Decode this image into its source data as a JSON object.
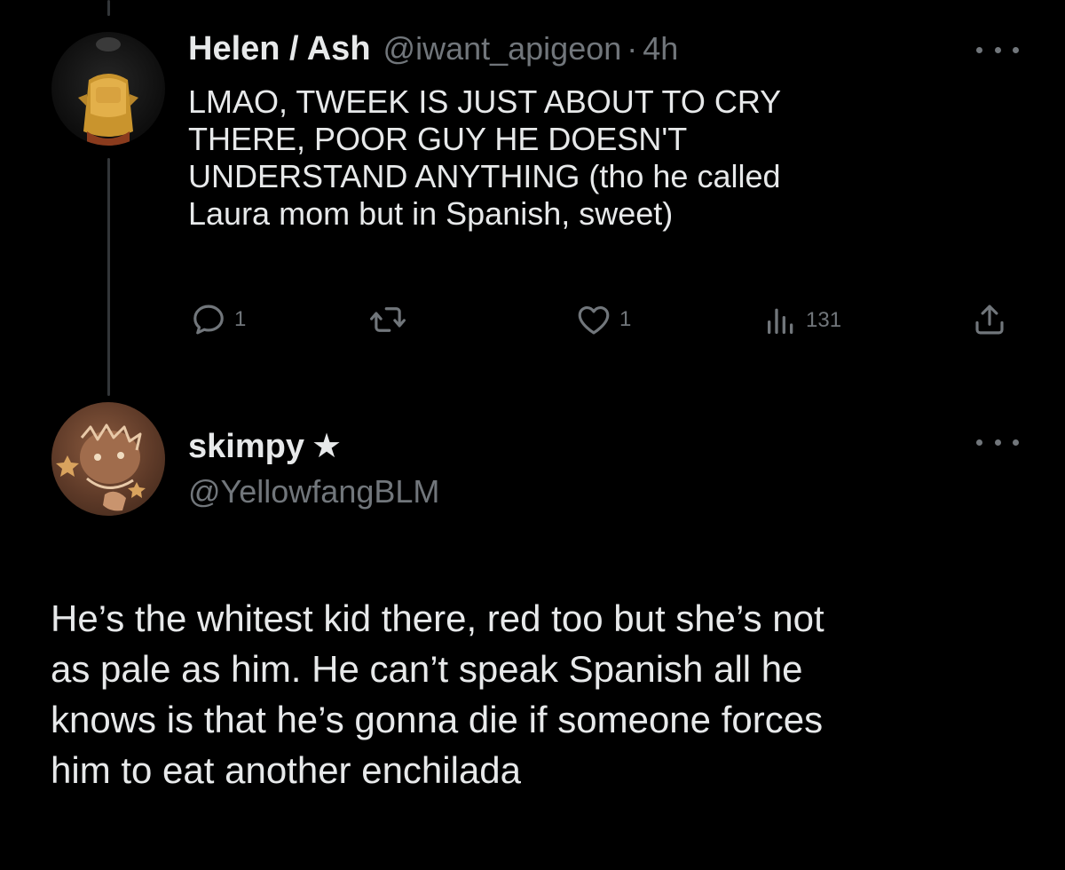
{
  "tweet": {
    "display_name": "Helen / Ash",
    "handle": "@iwant_apigeon",
    "separator": "·",
    "time": "4h",
    "text": "LMAO, TWEEK IS JUST ABOUT TO CRY\nTHERE, POOR GUY HE DOESN'T\nUNDERSTAND ANYTHING (tho he called\nLaura mom but in Spanish, sweet)",
    "replies": "1",
    "likes": "1",
    "views": "131",
    "icons": [
      "reply-icon",
      "retweet-icon",
      "like-icon",
      "views-icon",
      "share-icon",
      "more-icon"
    ]
  },
  "reply": {
    "display_name": "skimpy",
    "badge_glyph": "★",
    "handle": "@YellowfangBLM",
    "text": "He’s the whitest kid there, red too but she’s not\nas pale as him. He can’t speak Spanish all he\nknows is that he’s gonna die if someone forces\nhim to eat another enchilada"
  },
  "colors": {
    "background": "#000000",
    "text": "#e7e9ea",
    "secondary": "#71767b",
    "thread_line": "#333639"
  }
}
